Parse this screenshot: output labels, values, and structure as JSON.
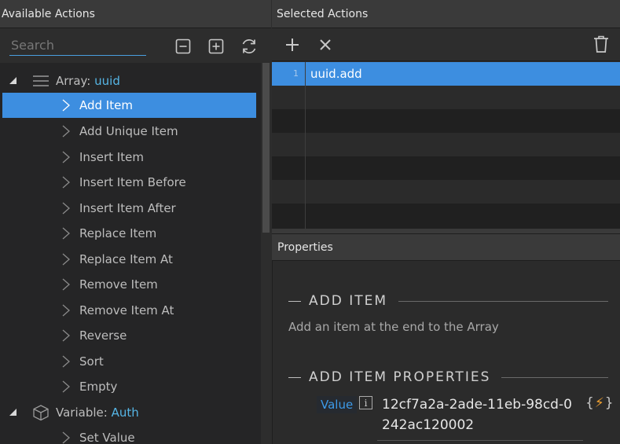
{
  "left_panel": {
    "title": "Available Actions",
    "search_placeholder": "Search",
    "toolbar": {
      "collapse_icon": "minus-square-icon",
      "expand_icon": "plus-square-icon",
      "refresh_icon": "refresh-icon"
    },
    "groups": [
      {
        "prefix": "Array:",
        "name": "uuid",
        "icon": "list-icon",
        "items": [
          "Add Item",
          "Add Unique Item",
          "Insert Item",
          "Insert Item Before",
          "Insert Item After",
          "Replace Item",
          "Replace Item At",
          "Remove Item",
          "Remove Item At",
          "Reverse",
          "Sort",
          "Empty"
        ],
        "selected_item": "Add Item"
      },
      {
        "prefix": "Variable:",
        "name": "Auth",
        "icon": "cube-icon",
        "items": [
          "Set Value"
        ]
      }
    ]
  },
  "right_panel": {
    "title": "Selected Actions",
    "toolbar": {
      "add_icon": "plus-icon",
      "remove_icon": "close-icon",
      "delete_icon": "trash-icon"
    },
    "selected_actions": [
      {
        "num": "1",
        "text": "uuid.add"
      }
    ]
  },
  "properties": {
    "title": "Properties",
    "section_title": "ADD ITEM",
    "description": "Add an item at the end to the Array",
    "props_title": "ADD ITEM PROPERTIES",
    "value_label": "Value",
    "info_glyph": "i",
    "value": "12cf7a2a-2ade-11eb-98cd-0242ac120002",
    "dynamic_open": "{",
    "dynamic_bolt": "⚡",
    "dynamic_close": "}"
  },
  "colors": {
    "accent": "#3d8ee0",
    "highlight_text": "#56b6e6",
    "bolt": "#f0a030"
  }
}
